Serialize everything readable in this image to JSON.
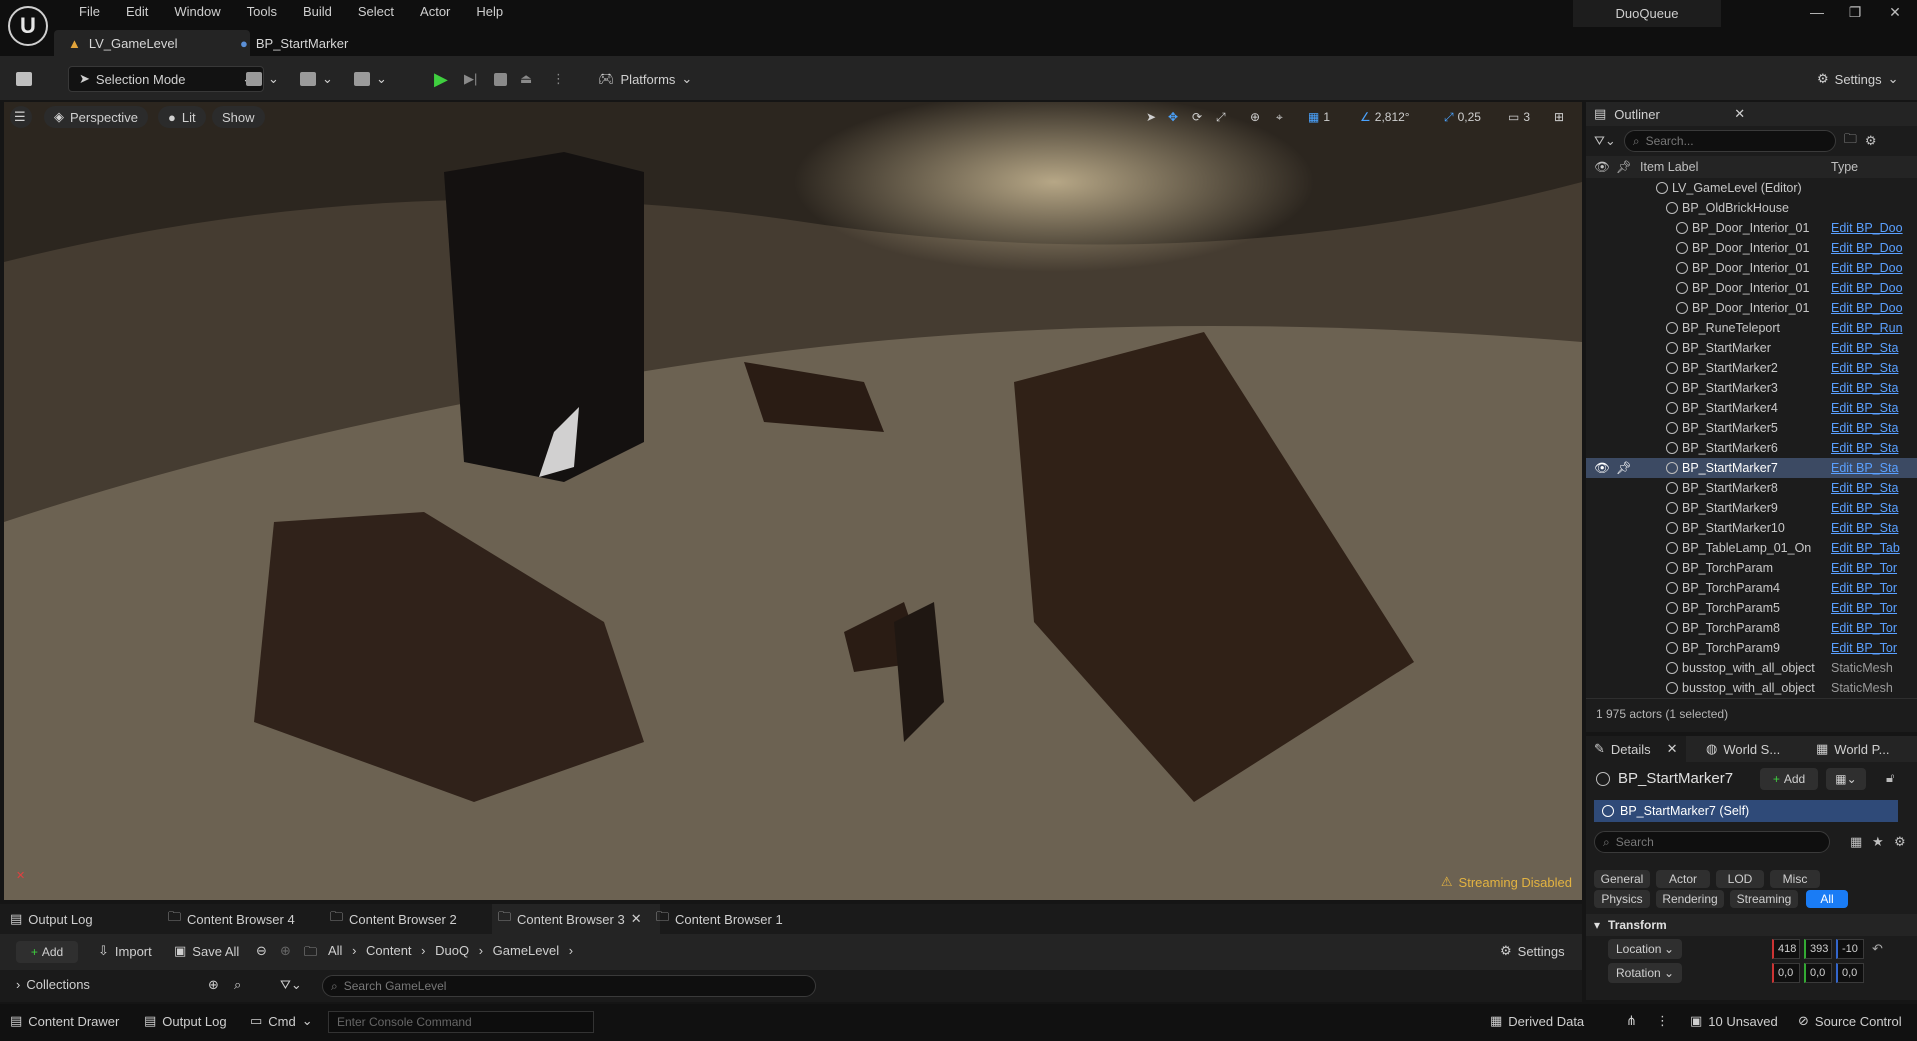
{
  "menu": [
    "File",
    "Edit",
    "Window",
    "Tools",
    "Build",
    "Select",
    "Actor",
    "Help"
  ],
  "tabs": [
    {
      "label": "LV_GameLevel"
    },
    {
      "label": "BP_StartMarker"
    }
  ],
  "project_name": "DuoQueue",
  "toolbar": {
    "selection_mode": "Selection Mode",
    "platforms": "Platforms",
    "settings": "Settings"
  },
  "viewport": {
    "perspective": "Perspective",
    "lit": "Lit",
    "show": "Show",
    "grid_value": "1",
    "angle_value": "2,812°",
    "scale_value": "0,25",
    "camera_value": "3",
    "streaming": "Streaming Disabled"
  },
  "outliner": {
    "title": "Outliner",
    "search_placeholder": "Search...",
    "col_label": "Item Label",
    "col_type": "Type",
    "rows": [
      {
        "label": "LV_GameLevel (Editor)",
        "type": "",
        "indent": 0
      },
      {
        "label": "BP_OldBrickHouse",
        "type": "",
        "indent": 1
      },
      {
        "label": "BP_Door_Interior_01",
        "type": "Edit BP_Doo",
        "indent": 2
      },
      {
        "label": "BP_Door_Interior_01",
        "type": "Edit BP_Doo",
        "indent": 2
      },
      {
        "label": "BP_Door_Interior_01",
        "type": "Edit BP_Doo",
        "indent": 2
      },
      {
        "label": "BP_Door_Interior_01",
        "type": "Edit BP_Doo",
        "indent": 2
      },
      {
        "label": "BP_Door_Interior_01",
        "type": "Edit BP_Doo",
        "indent": 2
      },
      {
        "label": "BP_RuneTeleport",
        "type": "Edit BP_Run",
        "indent": 1
      },
      {
        "label": "BP_StartMarker",
        "type": "Edit BP_Sta",
        "indent": 1
      },
      {
        "label": "BP_StartMarker2",
        "type": "Edit BP_Sta",
        "indent": 1
      },
      {
        "label": "BP_StartMarker3",
        "type": "Edit BP_Sta",
        "indent": 1
      },
      {
        "label": "BP_StartMarker4",
        "type": "Edit BP_Sta",
        "indent": 1
      },
      {
        "label": "BP_StartMarker5",
        "type": "Edit BP_Sta",
        "indent": 1
      },
      {
        "label": "BP_StartMarker6",
        "type": "Edit BP_Sta",
        "indent": 1
      },
      {
        "label": "BP_StartMarker7",
        "type": "Edit BP_Sta",
        "indent": 1,
        "selected": true
      },
      {
        "label": "BP_StartMarker8",
        "type": "Edit BP_Sta",
        "indent": 1
      },
      {
        "label": "BP_StartMarker9",
        "type": "Edit BP_Sta",
        "indent": 1
      },
      {
        "label": "BP_StartMarker10",
        "type": "Edit BP_Sta",
        "indent": 1
      },
      {
        "label": "BP_TableLamp_01_On",
        "type": "Edit BP_Tab",
        "indent": 1
      },
      {
        "label": "BP_TorchParam",
        "type": "Edit BP_Tor",
        "indent": 1
      },
      {
        "label": "BP_TorchParam4",
        "type": "Edit BP_Tor",
        "indent": 1
      },
      {
        "label": "BP_TorchParam5",
        "type": "Edit BP_Tor",
        "indent": 1
      },
      {
        "label": "BP_TorchParam8",
        "type": "Edit BP_Tor",
        "indent": 1
      },
      {
        "label": "BP_TorchParam9",
        "type": "Edit BP_Tor",
        "indent": 1
      },
      {
        "label": "busstop_with_all_object",
        "type": "StaticMesh",
        "indent": 1,
        "plain": true
      },
      {
        "label": "busstop_with_all_object",
        "type": "StaticMesh",
        "indent": 1,
        "plain": true
      }
    ],
    "footer": "1 975 actors (1 selected)"
  },
  "details": {
    "tab_details": "Details",
    "tab_world_settings": "World S...",
    "tab_world_partition": "World P...",
    "actor_name": "BP_StartMarker7",
    "add_label": "Add",
    "self_label": "BP_StartMarker7 (Self)",
    "search_placeholder": "Search",
    "filters_row1": [
      "General",
      "Actor",
      "LOD",
      "Misc"
    ],
    "filters_row2": [
      "Physics",
      "Rendering",
      "Streaming",
      "All"
    ],
    "section": "Transform",
    "location_label": "Location",
    "rotation_label": "Rotation",
    "location": [
      "418",
      "393",
      "-10"
    ],
    "rotation": [
      "0,0",
      "0,0",
      "0,0"
    ]
  },
  "bottom_tabs": [
    "Output Log",
    "Content Browser 4",
    "Content Browser 2",
    "Content Browser 3",
    "Content Browser 1"
  ],
  "content_browser": {
    "add": "Add",
    "import": "Import",
    "save_all": "Save All",
    "path": [
      "All",
      "Content",
      "DuoQ",
      "GameLevel"
    ],
    "settings": "Settings",
    "collections": "Collections",
    "search_placeholder": "Search GameLevel"
  },
  "status": {
    "content_drawer": "Content Drawer",
    "output_log": "Output Log",
    "cmd": "Cmd",
    "console_placeholder": "Enter Console Command",
    "derived_data": "Derived Data",
    "unsaved": "10 Unsaved",
    "source_control": "Source Control"
  }
}
